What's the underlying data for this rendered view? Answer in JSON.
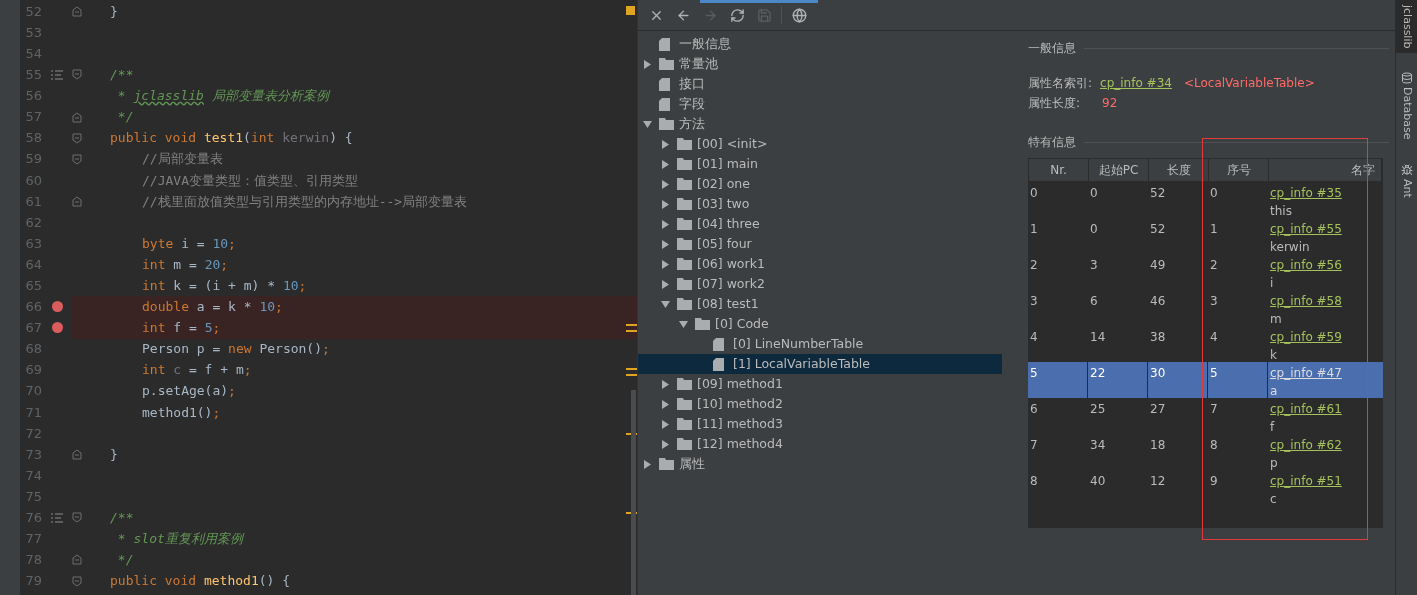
{
  "editor": {
    "lines": [
      {
        "number": "52",
        "breakpoint": false,
        "gutter": [
          {
            "kind": "fold_end"
          }
        ],
        "tokens": [
          {
            "kind": "plain",
            "text": "}"
          }
        ]
      },
      {
        "number": "53",
        "breakpoint": false
      },
      {
        "number": "54",
        "breakpoint": false
      },
      {
        "number": "55",
        "breakpoint": false,
        "gutter": [
          {
            "kind": "doc"
          },
          {
            "kind": "fold_start"
          }
        ],
        "tokens": [
          {
            "kind": "doc",
            "text": "/**"
          }
        ]
      },
      {
        "number": "56",
        "breakpoint": false,
        "tokens": [
          {
            "kind": "doc",
            "text": " * "
          },
          {
            "kind": "typo",
            "text": "jclasslib"
          },
          {
            "kind": "doc",
            "text": " 局部变量表分析案例"
          }
        ]
      },
      {
        "number": "57",
        "breakpoint": false,
        "gutter": [
          {
            "kind": "fold_end"
          }
        ],
        "tokens": [
          {
            "kind": "doc",
            "text": " */"
          }
        ]
      },
      {
        "number": "58",
        "breakpoint": false,
        "gutter": [
          {
            "kind": "fold_start"
          }
        ],
        "tokens": [
          {
            "kind": "keyword",
            "text": "public void "
          },
          {
            "kind": "method",
            "text": "test1"
          },
          {
            "kind": "plain",
            "text": "("
          },
          {
            "kind": "keyword",
            "text": "int "
          },
          {
            "kind": "unused",
            "text": "kerwin"
          },
          {
            "kind": "plain",
            "text": ") {"
          }
        ],
        "children": [
          {
            "number": "59",
            "breakpoint": false,
            "gutter": [
              {
                "kind": "fold_start"
              }
            ],
            "tokens": [
              {
                "kind": "comment",
                "text": "//局部变量表"
              }
            ]
          },
          {
            "number": "60",
            "breakpoint": false,
            "tokens": [
              {
                "kind": "comment",
                "text": "//JAVA变量类型：值类型、引用类型"
              }
            ]
          },
          {
            "number": "61",
            "breakpoint": false,
            "gutter": [
              {
                "kind": "fold_end"
              }
            ],
            "tokens": [
              {
                "kind": "comment",
                "text": "//栈里面放值类型与引用类型的内存地址-->局部变量表"
              }
            ]
          },
          {
            "number": "62",
            "breakpoint": false
          },
          {
            "number": "63",
            "breakpoint": false,
            "tokens": [
              {
                "kind": "keyword",
                "text": "byte "
              },
              {
                "kind": "plain",
                "text": "i = "
              },
              {
                "kind": "number",
                "text": "10"
              },
              {
                "kind": "keyword",
                "text": ";"
              }
            ]
          },
          {
            "number": "64",
            "breakpoint": false,
            "tokens": [
              {
                "kind": "keyword",
                "text": "int "
              },
              {
                "kind": "plain",
                "text": "m = "
              },
              {
                "kind": "number",
                "text": "20"
              },
              {
                "kind": "keyword",
                "text": ";"
              }
            ]
          },
          {
            "number": "65",
            "breakpoint": false,
            "tokens": [
              {
                "kind": "keyword",
                "text": "int "
              },
              {
                "kind": "plain",
                "text": "k = (i + m) * "
              },
              {
                "kind": "number",
                "text": "10"
              },
              {
                "kind": "keyword",
                "text": ";"
              }
            ]
          },
          {
            "number": "66",
            "breakpoint": true,
            "tokens": [
              {
                "kind": "keyword",
                "text": "double "
              },
              {
                "kind": "plain",
                "text": "a = k * "
              },
              {
                "kind": "number",
                "text": "10"
              },
              {
                "kind": "keyword",
                "text": ";"
              }
            ]
          },
          {
            "number": "67",
            "breakpoint": true,
            "tokens": [
              {
                "kind": "keyword",
                "text": "int "
              },
              {
                "kind": "plain",
                "text": "f = "
              },
              {
                "kind": "number",
                "text": "5"
              },
              {
                "kind": "keyword",
                "text": ";"
              }
            ]
          },
          {
            "number": "68",
            "breakpoint": false,
            "tokens": [
              {
                "kind": "plain",
                "text": "Person p = "
              },
              {
                "kind": "keyword",
                "text": "new "
              },
              {
                "kind": "plain",
                "text": "Person()"
              },
              {
                "kind": "keyword",
                "text": ";"
              }
            ]
          },
          {
            "number": "69",
            "breakpoint": false,
            "tokens": [
              {
                "kind": "keyword",
                "text": "int "
              },
              {
                "kind": "unused",
                "text": "c"
              },
              {
                "kind": "plain",
                "text": " = f + m"
              },
              {
                "kind": "keyword",
                "text": ";"
              }
            ]
          },
          {
            "number": "70",
            "breakpoint": false,
            "tokens": [
              {
                "kind": "plain",
                "text": "p.setAge(a)"
              },
              {
                "kind": "keyword",
                "text": ";"
              }
            ]
          },
          {
            "number": "71",
            "breakpoint": false,
            "tokens": [
              {
                "kind": "plain",
                "text": "method1()"
              },
              {
                "kind": "keyword",
                "text": ";"
              }
            ]
          },
          {
            "number": "72",
            "breakpoint": false
          }
        ]
      },
      {
        "number": "73",
        "breakpoint": false,
        "gutter": [
          {
            "kind": "fold_end"
          }
        ],
        "tokens": [
          {
            "kind": "plain",
            "text": "}"
          }
        ]
      },
      {
        "number": "74",
        "breakpoint": false
      },
      {
        "number": "75",
        "breakpoint": false
      },
      {
        "number": "76",
        "breakpoint": false,
        "gutter": [
          {
            "kind": "doc"
          },
          {
            "kind": "fold_start"
          }
        ],
        "tokens": [
          {
            "kind": "doc",
            "text": "/**"
          }
        ]
      },
      {
        "number": "77",
        "breakpoint": false,
        "tokens": [
          {
            "kind": "doc",
            "text": " * slot重复利用案例"
          }
        ]
      },
      {
        "number": "78",
        "breakpoint": false,
        "gutter": [
          {
            "kind": "fold_end"
          }
        ],
        "tokens": [
          {
            "kind": "doc",
            "text": " */"
          }
        ]
      },
      {
        "number": "79",
        "breakpoint": false,
        "gutter": [
          {
            "kind": "fold_start"
          }
        ],
        "tokens": [
          {
            "kind": "keyword",
            "text": "public void "
          },
          {
            "kind": "method",
            "text": "method1"
          },
          {
            "kind": "plain",
            "text": "() {"
          }
        ]
      }
    ]
  },
  "toolbar": [
    {
      "kind": "close",
      "disabled": false
    },
    {
      "kind": "back",
      "disabled": false
    },
    {
      "kind": "forward",
      "disabled": true
    },
    {
      "kind": "refresh",
      "disabled": false
    },
    {
      "kind": "save",
      "disabled": true
    },
    {
      "kind": "web",
      "disabled": false
    }
  ],
  "tree": [
    {
      "label": "一般信息",
      "kind": "file",
      "selected": false
    },
    {
      "label": "常量池",
      "kind": "folder",
      "expanded": false,
      "selected": false
    },
    {
      "label": "接口",
      "kind": "file",
      "selected": false
    },
    {
      "label": "字段",
      "kind": "file",
      "selected": false
    },
    {
      "label": "方法",
      "kind": "folder",
      "expanded": true,
      "selected": false,
      "children": [
        {
          "label": "[00] <init>",
          "kind": "folder",
          "expanded": false,
          "selected": false
        },
        {
          "label": "[01] main",
          "kind": "folder",
          "expanded": false,
          "selected": false
        },
        {
          "label": "[02] one",
          "kind": "folder",
          "expanded": false,
          "selected": false
        },
        {
          "label": "[03] two",
          "kind": "folder",
          "expanded": false,
          "selected": false
        },
        {
          "label": "[04] three",
          "kind": "folder",
          "expanded": false,
          "selected": false
        },
        {
          "label": "[05] four",
          "kind": "folder",
          "expanded": false,
          "selected": false
        },
        {
          "label": "[06] work1",
          "kind": "folder",
          "expanded": false,
          "selected": false
        },
        {
          "label": "[07] work2",
          "kind": "folder",
          "expanded": false,
          "selected": false
        },
        {
          "label": "[08] test1",
          "kind": "folder",
          "expanded": true,
          "selected": false,
          "children": [
            {
              "label": "[0] Code",
              "kind": "folder",
              "expanded": true,
              "selected": false,
              "children": [
                {
                  "label": "[0] LineNumberTable",
                  "kind": "file",
                  "selected": false
                },
                {
                  "label": "[1] LocalVariableTable",
                  "kind": "file",
                  "selected": true
                }
              ]
            }
          ]
        },
        {
          "label": "[09] method1",
          "kind": "folder",
          "expanded": false,
          "selected": false
        },
        {
          "label": "[10] method2",
          "kind": "folder",
          "expanded": false,
          "selected": false
        },
        {
          "label": "[11] method3",
          "kind": "folder",
          "expanded": false,
          "selected": false
        },
        {
          "label": "[12] method4",
          "kind": "folder",
          "expanded": false,
          "selected": false
        }
      ]
    },
    {
      "label": "属性",
      "kind": "folder",
      "expanded": false,
      "selected": false
    }
  ],
  "general": {
    "title": "一般信息",
    "name_index_label": "属性名索引:",
    "name_index_link": "cp_info #34",
    "name_index_value": "<LocalVariableTable>",
    "length_label": "属性长度:",
    "length_value": "92"
  },
  "specific": {
    "title": "特有信息",
    "columns": [
      "Nr.",
      "起始PC",
      "长度",
      "序号",
      "名字"
    ],
    "rows": [
      {
        "cells": [
          "0",
          "0",
          "52",
          "0"
        ],
        "link": "cp_info #35",
        "name": "this",
        "selected": false
      },
      {
        "cells": [
          "1",
          "0",
          "52",
          "1"
        ],
        "link": "cp_info #55",
        "name": "kerwin",
        "selected": false
      },
      {
        "cells": [
          "2",
          "3",
          "49",
          "2"
        ],
        "link": "cp_info #56",
        "name": "i",
        "selected": false
      },
      {
        "cells": [
          "3",
          "6",
          "46",
          "3"
        ],
        "link": "cp_info #58",
        "name": "m",
        "selected": false
      },
      {
        "cells": [
          "4",
          "14",
          "38",
          "4"
        ],
        "link": "cp_info #59",
        "name": "k",
        "selected": false
      },
      {
        "cells": [
          "5",
          "22",
          "30",
          "5"
        ],
        "link": "cp_info #47",
        "name": "a",
        "selected": true
      },
      {
        "cells": [
          "6",
          "25",
          "27",
          "7"
        ],
        "link": "cp_info #61",
        "name": "f",
        "selected": false
      },
      {
        "cells": [
          "7",
          "34",
          "18",
          "8"
        ],
        "link": "cp_info #62",
        "name": "p",
        "selected": false
      },
      {
        "cells": [
          "8",
          "40",
          "12",
          "9"
        ],
        "link": "cp_info #51",
        "name": "c",
        "selected": false
      }
    ]
  },
  "side_tabs": [
    {
      "label": "jclasslib",
      "kind": "class",
      "selected": true
    },
    {
      "label": "Database",
      "kind": "database",
      "selected": false
    },
    {
      "label": "Ant",
      "kind": "ant",
      "selected": false
    }
  ]
}
